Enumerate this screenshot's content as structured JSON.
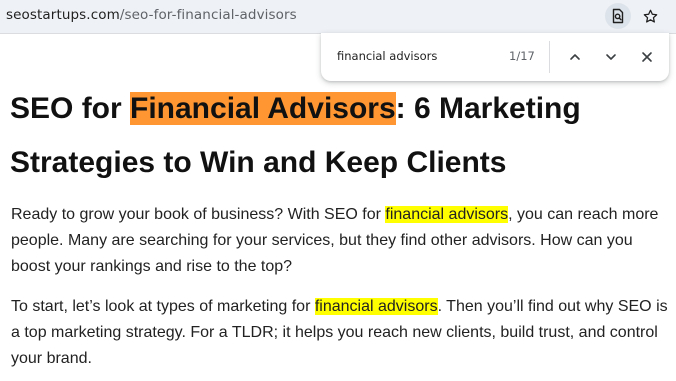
{
  "browser": {
    "url_domain": "seostartups.com",
    "url_path": "/seo-for-financial-advisors",
    "icons": {
      "find_in_page": "find-in-page-icon",
      "bookmark": "star-icon"
    }
  },
  "find_bar": {
    "query": "financial advisors",
    "match_count": "1/17",
    "icons": {
      "prev": "chevron-up-icon",
      "next": "chevron-down-icon",
      "close": "close-icon"
    }
  },
  "article": {
    "title_before": "SEO for ",
    "title_match": "Financial Advisors",
    "title_after": ": 6 Marketing Strategies to Win and Keep Clients",
    "paragraph_1": {
      "before": "Ready to grow your book of business? With SEO for ",
      "match": "financial advisors",
      "after": ", you can reach more people. Many are searching for your services, but they find other advisors. How can you boost your rankings and rise to the top?"
    },
    "paragraph_2": {
      "before": "To start, let’s look at types of marketing for ",
      "match": "financial advisors",
      "after": ". Then you’ll find out why SEO is a top marketing strategy. For a TLDR; it helps you reach new clients, build trust, and control your brand."
    }
  },
  "colors": {
    "current_match_highlight": "#ff9632",
    "match_highlight": "#ffff00",
    "toolbar_background": "#eef1f6"
  }
}
